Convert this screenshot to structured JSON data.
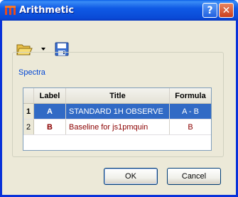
{
  "window": {
    "title": "Arithmetic",
    "help_glyph": "?",
    "close_glyph": "✕",
    "colors": {
      "titlebar": "#0a4ad6",
      "client": "#ece9d8"
    }
  },
  "toolbar": {
    "icons": [
      "open-folder-icon",
      "dropdown-arrow-icon",
      "save-icon"
    ]
  },
  "spectra": {
    "group_label": "Spectra",
    "columns": [
      "",
      "Label",
      "Title",
      "Formula"
    ],
    "rows": [
      {
        "index": "1",
        "label": "A",
        "title": "STANDARD 1H OBSERVE",
        "formula": "A - B",
        "selected": true
      },
      {
        "index": "2",
        "label": "B",
        "title": "Baseline for js1pmquin",
        "formula": "B",
        "selected": false
      }
    ],
    "colors": {
      "selection": "#316ac5",
      "label_text": "#8b0000"
    }
  },
  "buttons": {
    "ok": "OK",
    "cancel": "Cancel"
  }
}
